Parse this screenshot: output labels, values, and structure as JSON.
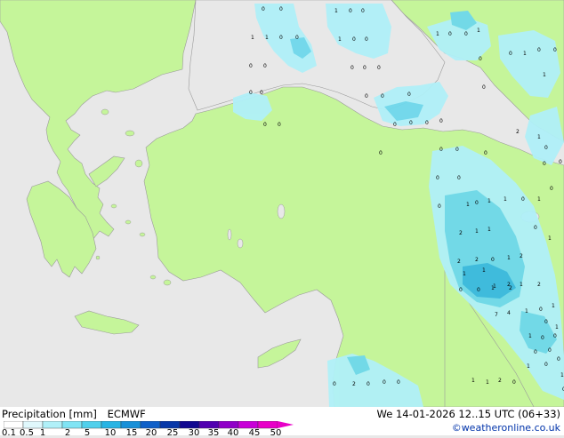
{
  "title": "Precipitation [mm]",
  "model": "ECMWF",
  "valid_time": "We 14-01-2026 12..15 UTC (06+33)",
  "credit": "©weatheronline.co.uk",
  "colors": {
    "sea": "#e8e8e8",
    "land": "#c5f59a",
    "precip_light": "#b0f0f8",
    "precip_mid": "#6ed8ec",
    "precip_high": "#38b8e0"
  },
  "legend": {
    "ticks": [
      "0.1",
      "0.5",
      "1",
      "2",
      "5",
      "10",
      "15",
      "20",
      "25",
      "30",
      "35",
      "40",
      "45",
      "50"
    ],
    "colors": [
      "#ffffff",
      "#e0f8fc",
      "#b0f0f8",
      "#80e4f4",
      "#50d0ec",
      "#28b4e4",
      "#1890d8",
      "#1060c8",
      "#0838a8",
      "#100890",
      "#5000b0",
      "#9000c8",
      "#c800d8",
      "#e800c8"
    ]
  },
  "map_values": [
    "0",
    "0",
    "1",
    "0",
    "0",
    "1",
    "1",
    "0",
    "0",
    "1",
    "0",
    "0",
    "1",
    "1",
    "0",
    "0",
    "0",
    "0",
    "0",
    "0",
    "0",
    "0",
    "0",
    "1",
    "0",
    "0",
    "0",
    "0",
    "0",
    "0",
    "0",
    "0",
    "1",
    "0",
    "0",
    "0",
    "0",
    "0",
    "0",
    "2",
    "1",
    "0",
    "0",
    "0",
    "0",
    "0",
    "0",
    "0",
    "0",
    "0",
    "0",
    "1",
    "0",
    "1",
    "1",
    "0",
    "1",
    "0",
    "2",
    "1",
    "1",
    "0",
    "1",
    "2",
    "2",
    "0",
    "1",
    "2",
    "0",
    "0",
    "1",
    "2",
    "1",
    "2",
    "1",
    "1",
    "1",
    "2",
    "7",
    "4",
    "1",
    "0",
    "1",
    "0",
    "1",
    "1",
    "0",
    "0",
    "0",
    "2",
    "0",
    "0",
    "0",
    "1",
    "0",
    "0",
    "1",
    "0",
    "0",
    "2",
    "1",
    "1",
    "0",
    "0"
  ]
}
